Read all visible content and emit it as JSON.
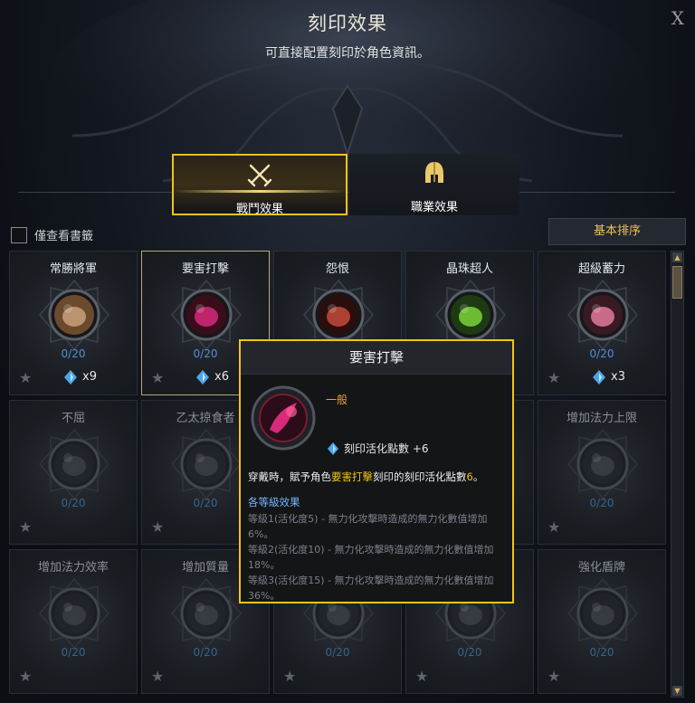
{
  "header": {
    "title": "刻印效果",
    "subtitle": "可直接配置刻印於角色資訊。",
    "close_label": "X"
  },
  "tabs": [
    {
      "label": "戰鬥效果",
      "icon": "crossed-swords-icon",
      "active": true
    },
    {
      "label": "職業效果",
      "icon": "helmet-icon",
      "active": false
    }
  ],
  "filter": {
    "label": "僅查看書籤",
    "checked": false
  },
  "sort_button": {
    "label": "基本排序"
  },
  "engravings": [
    {
      "name": "常勝將軍",
      "count": "0/20",
      "multiplier": "x9",
      "icon": "eye-icon",
      "dim": false
    },
    {
      "name": "要害打擊",
      "count": "0/20",
      "multiplier": "x6",
      "icon": "critical-strike-icon",
      "dim": false,
      "selected": true
    },
    {
      "name": "怨恨",
      "count": "",
      "multiplier": "",
      "icon": "grudge-icon",
      "dim": false
    },
    {
      "name": "晶珠超人",
      "count": "",
      "multiplier": "",
      "icon": "ether-icon",
      "dim": false
    },
    {
      "name": "超級蓄力",
      "count": "0/20",
      "multiplier": "x3",
      "icon": "charge-icon",
      "dim": false
    },
    {
      "name": "不屈",
      "count": "0/20",
      "multiplier": "",
      "icon": "indomitable-icon",
      "dim": true
    },
    {
      "name": "乙太掠食者",
      "count": "0/20",
      "multiplier": "",
      "icon": "ether-predator-icon",
      "dim": true
    },
    {
      "name": "",
      "count": "",
      "multiplier": "",
      "icon": "",
      "dim": true
    },
    {
      "name": "",
      "count": "",
      "multiplier": "",
      "icon": "",
      "dim": true
    },
    {
      "name": "增加法力上限",
      "count": "0/20",
      "multiplier": "",
      "icon": "max-mana-icon",
      "dim": true
    },
    {
      "name": "增加法力效率",
      "count": "0/20",
      "multiplier": "",
      "icon": "mana-efficiency-icon",
      "dim": true
    },
    {
      "name": "增加質量",
      "count": "0/20",
      "multiplier": "",
      "icon": "mass-increase-icon",
      "dim": true
    },
    {
      "name": "",
      "count": "0/20",
      "multiplier": "",
      "icon": "",
      "dim": true
    },
    {
      "name": "",
      "count": "0/20",
      "multiplier": "",
      "icon": "",
      "dim": true
    },
    {
      "name": "強化盾牌",
      "count": "0/20",
      "multiplier": "",
      "icon": "shield-icon",
      "dim": true
    }
  ],
  "tooltip": {
    "title": "要害打擊",
    "grade": "一般",
    "activation": "刻印活化點數 +6",
    "desc_prefix": "穿戴時，賦予角色",
    "desc_name": "要害打擊",
    "desc_mid": "刻印的刻印活化點數",
    "desc_value": "6",
    "desc_suffix": "。",
    "level_header": "各等級效果",
    "levels": [
      "等級1(活化度5) - 無力化攻擊時造成的無力化數值增加6%。",
      "等級2(活化度10) - 無力化攻擊時造成的無力化數值增加18%。",
      "等級3(活化度15) - 無力化攻擊時造成的無力化數值增加36%。"
    ]
  },
  "colors": {
    "accent": "#f0c419",
    "count_blue": "#4d8fd8",
    "grade_orange": "#f0a030",
    "level_blue": "#79b4ff"
  }
}
